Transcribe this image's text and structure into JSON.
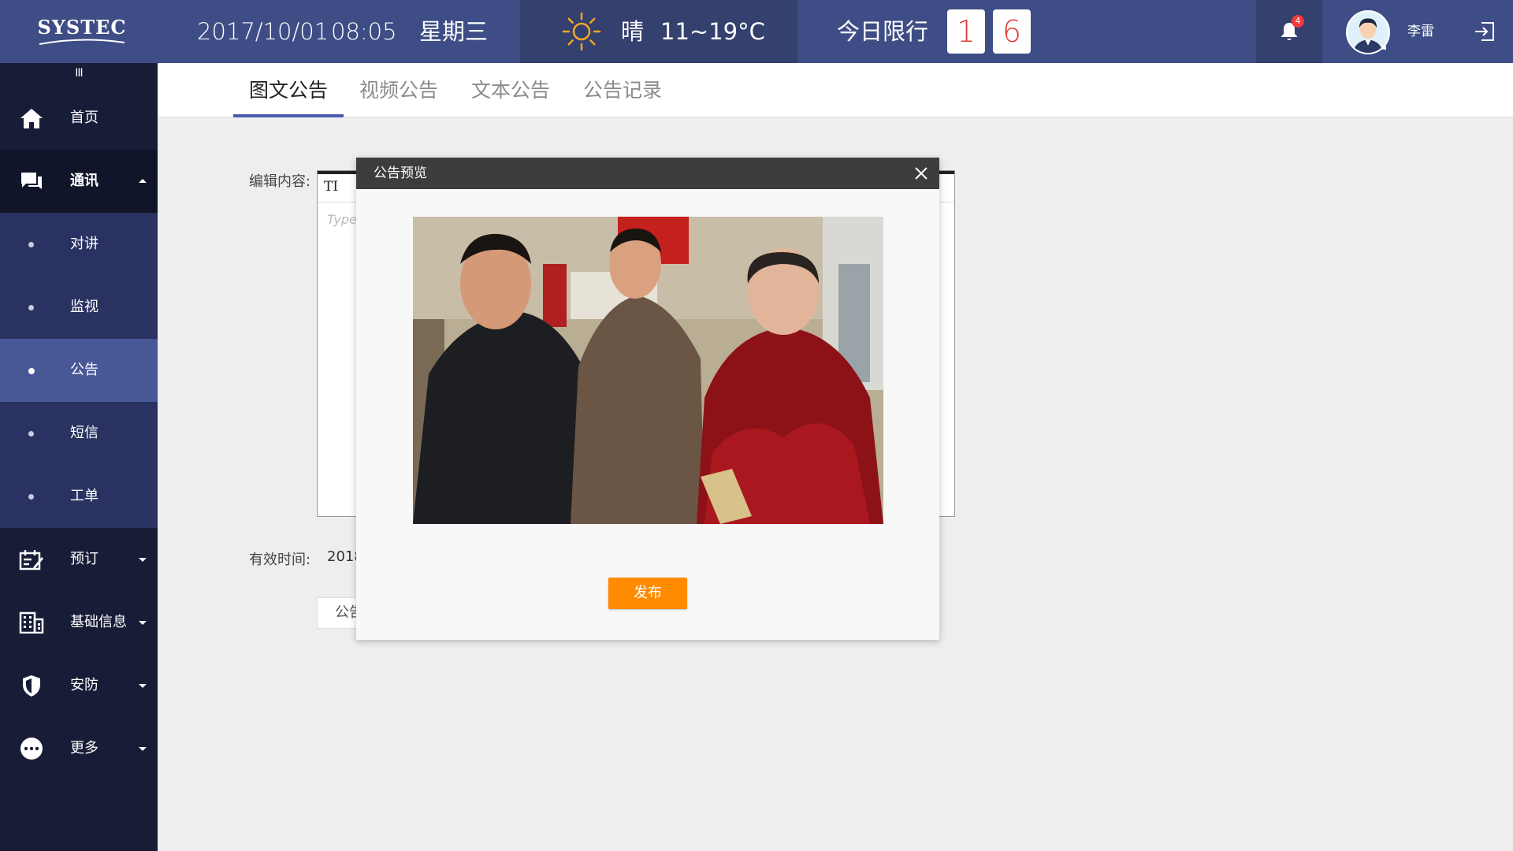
{
  "header": {
    "logo": "SYSTEC",
    "date": "2017/10/01",
    "time": "08:05",
    "weekday": "星期三",
    "weather": {
      "condition": "晴",
      "temp": "11~19°C",
      "icon": "sun-icon"
    },
    "traffic_limit": {
      "label": "今日限行",
      "digits": [
        "1",
        "6"
      ]
    },
    "notifications": {
      "count": "4",
      "icon": "bell-icon"
    },
    "user": {
      "name": "李雷"
    },
    "logout_icon": "logout-icon"
  },
  "sidebar": {
    "toggle": "III",
    "items": [
      {
        "label": "首页",
        "icon": "home-icon"
      },
      {
        "label": "通讯",
        "icon": "chat-icon",
        "expanded": true
      },
      {
        "label": "对讲"
      },
      {
        "label": "监视"
      },
      {
        "label": "公告",
        "active": true
      },
      {
        "label": "短信"
      },
      {
        "label": "工单"
      },
      {
        "label": "预订",
        "icon": "booking-icon"
      },
      {
        "label": "基础信息",
        "icon": "building-icon"
      },
      {
        "label": "安防",
        "icon": "shield-icon"
      },
      {
        "label": "更多",
        "icon": "more-icon"
      }
    ]
  },
  "tabs": [
    {
      "label": "图文公告",
      "active": true
    },
    {
      "label": "视频公告"
    },
    {
      "label": "文本公告"
    },
    {
      "label": "公告记录"
    }
  ],
  "form": {
    "content_label": "编辑内容:",
    "toolbar_tool": "TI",
    "placeholder": "Type",
    "valid_time_label": "有效时间:",
    "valid_time_value": "2018",
    "bottom_button": "公告"
  },
  "modal": {
    "title": "公告预览",
    "publish_label": "发布"
  },
  "colors": {
    "header": "#3e4d85",
    "sidebar": "#181d37",
    "sidebar_sub": "#2a3261",
    "sidebar_active": "#485796",
    "accent": "#ff8c00",
    "plate_text": "#e03a3a"
  }
}
